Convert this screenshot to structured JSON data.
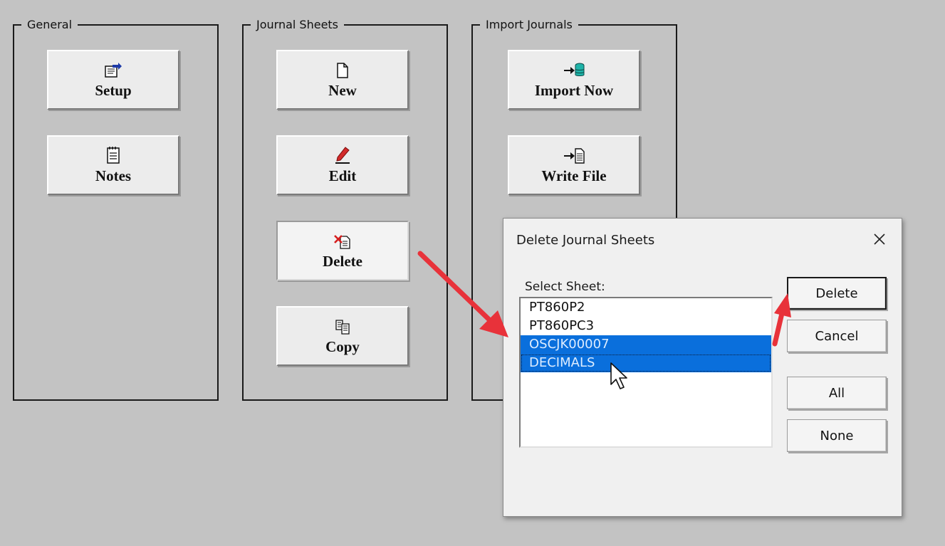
{
  "groups": {
    "general": {
      "title": "General",
      "setup_label": "Setup",
      "notes_label": "Notes"
    },
    "journal_sheets": {
      "title": "Journal Sheets",
      "new_label": "New",
      "edit_label": "Edit",
      "delete_label": "Delete",
      "copy_label": "Copy"
    },
    "import_journals": {
      "title": "Import Journals",
      "import_now_label": "Import Now",
      "write_file_label": "Write File"
    }
  },
  "dialog": {
    "title": "Delete Journal Sheets",
    "select_label": "Select Sheet:",
    "sheets": [
      {
        "name": "PT860P2",
        "selected": false
      },
      {
        "name": "PT860PC3",
        "selected": false
      },
      {
        "name": "OSCJK00007",
        "selected": true
      },
      {
        "name": "DECIMALS",
        "selected": true
      }
    ],
    "buttons": {
      "delete": "Delete",
      "cancel": "Cancel",
      "all": "All",
      "none": "None"
    }
  },
  "colors": {
    "selection": "#0a6fdc",
    "annotation_arrow": "#e8323a"
  }
}
